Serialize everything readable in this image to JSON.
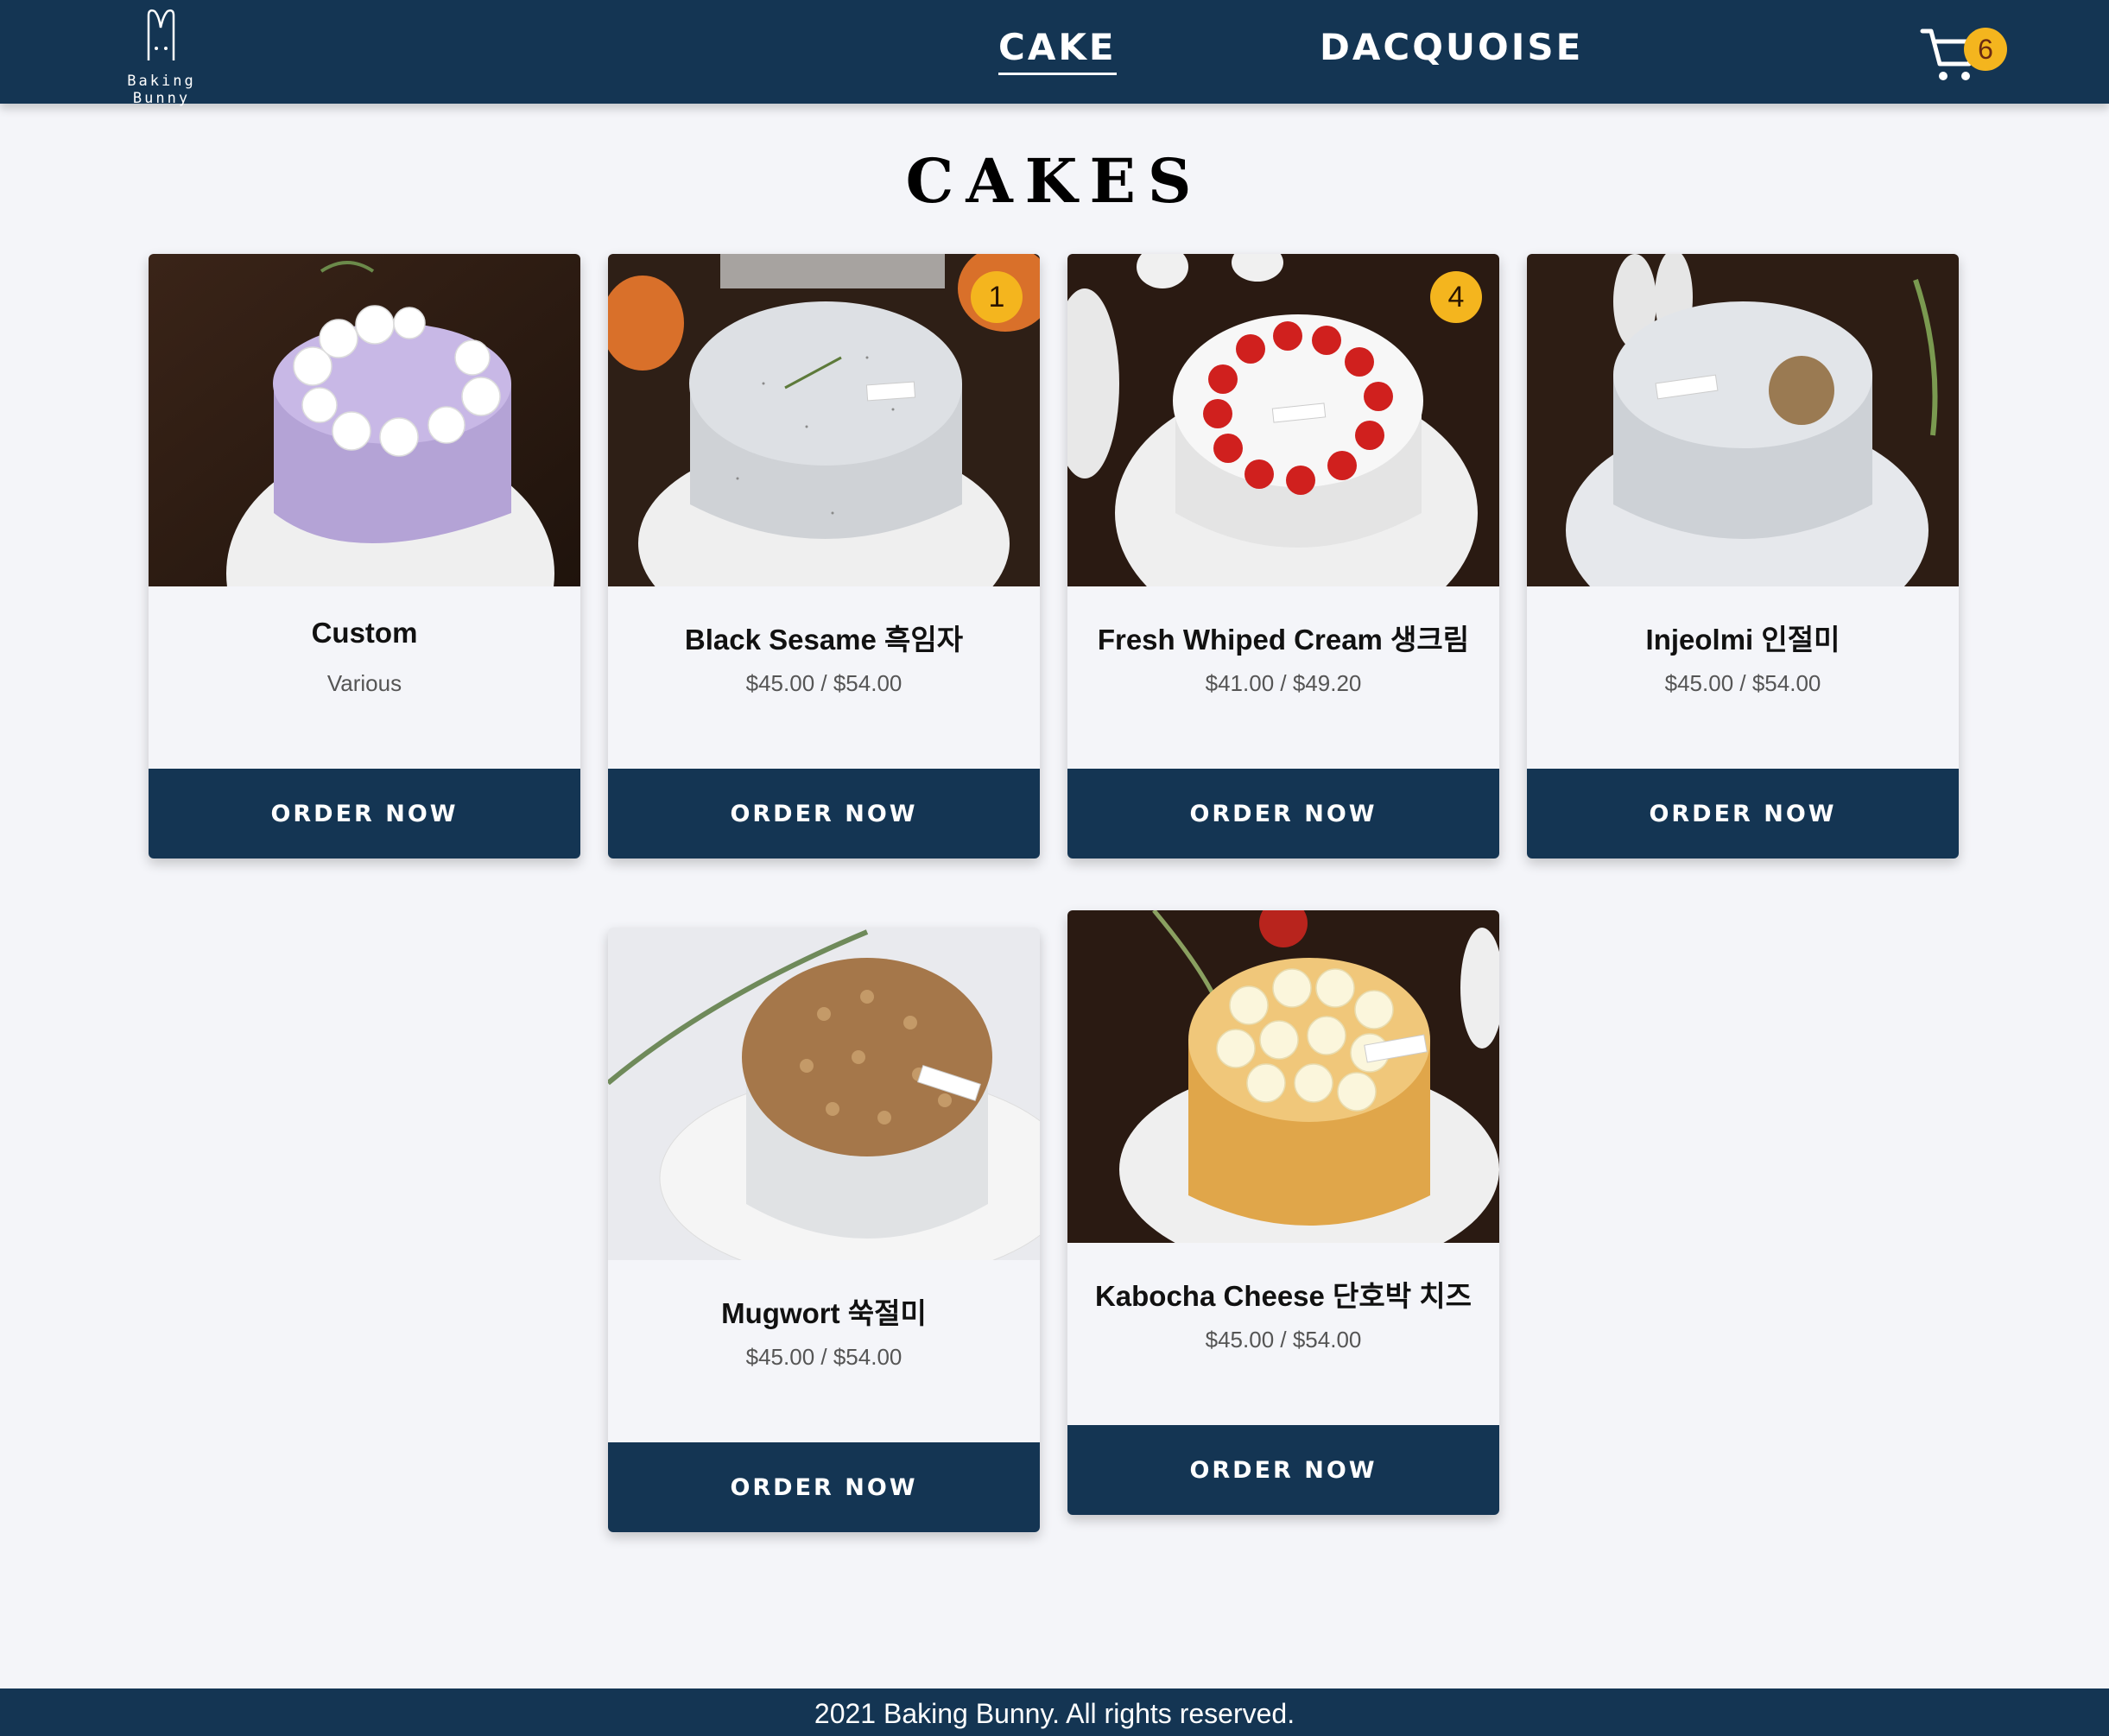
{
  "header": {
    "logo_text": "Baking Bunny",
    "nav": [
      {
        "label": "CAKE",
        "active": true
      },
      {
        "label": "DACQUOISE",
        "active": false
      }
    ],
    "cart_count": "6"
  },
  "page_title": "CAKES",
  "products": [
    {
      "name": "Custom",
      "price": "Various",
      "badge": "",
      "button": "ORDER NOW",
      "cake": "lavender cake with white flowers"
    },
    {
      "name": "Black Sesame 흑임자",
      "price": "$45.00 / $54.00",
      "badge": "1",
      "button": "ORDER NOW",
      "cake": "speckled grey cake with thyme"
    },
    {
      "name": "Fresh Whiped Cream 생크림",
      "price": "$41.00 / $49.20",
      "badge": "4",
      "button": "ORDER NOW",
      "cake": "white cake with strawberry ring"
    },
    {
      "name": "Injeolmi 인절미",
      "price": "$45.00 / $54.00",
      "badge": "",
      "button": "ORDER NOW",
      "cake": "white cake with cookie"
    },
    {
      "name": "Mugwort 쑥절미",
      "price": "$45.00 / $54.00",
      "badge": "",
      "button": "ORDER NOW",
      "cake": "crumble topped cake"
    },
    {
      "name": "Kabocha Cheese 단호박 치즈",
      "price": "$45.00 / $54.00",
      "badge": "",
      "button": "ORDER NOW",
      "cake": "cheesecake with cream dollops"
    }
  ],
  "footer": {
    "text": "2021 Baking Bunny. All rights reserved."
  },
  "colors": {
    "navy": "#143553",
    "accent": "#f4b51e",
    "background": "#f4f5f9"
  }
}
